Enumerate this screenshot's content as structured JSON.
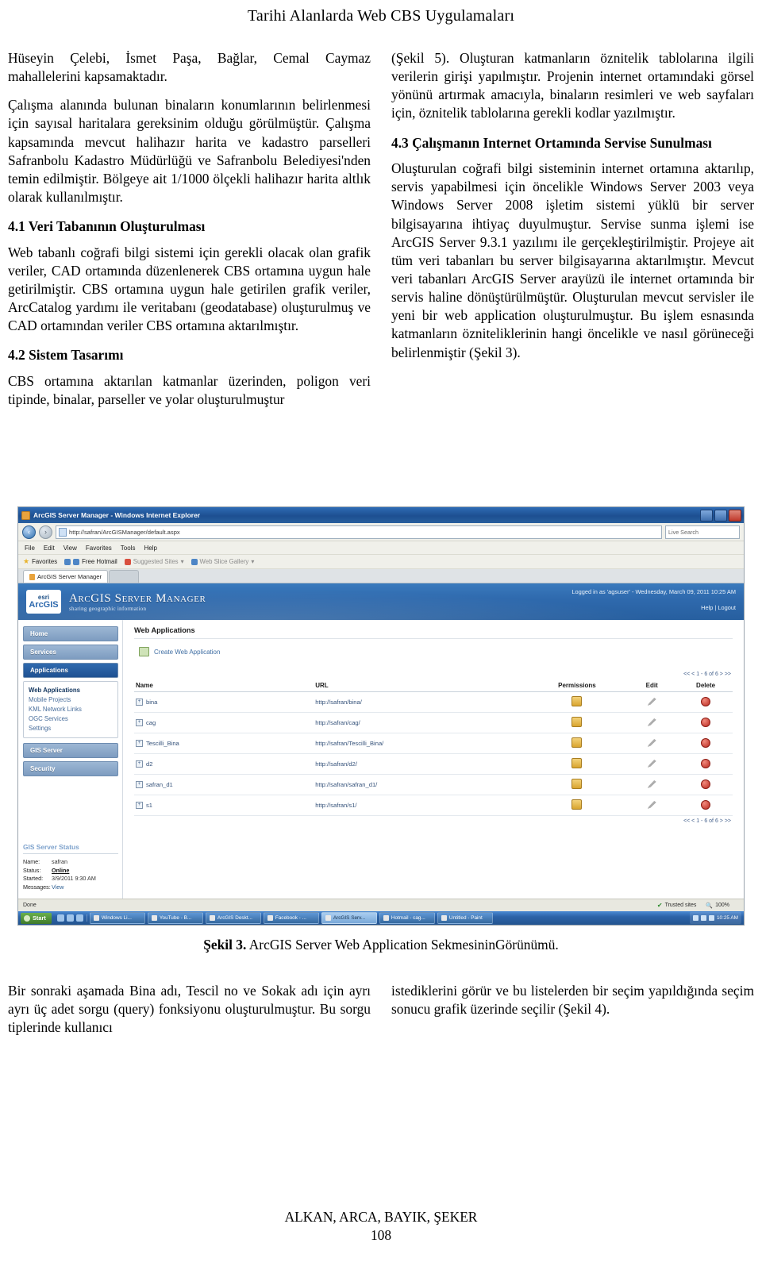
{
  "running_head": "Tarihi Alanlarda Web CBS Uygulamaları",
  "left_column": {
    "p1": "Hüseyin Çelebi, İsmet Paşa, Bağlar, Cemal Caymaz mahallelerini kapsamaktadır.",
    "p2": "Çalışma alanında bulunan binaların konumlarının belirlenmesi için sayısal haritalara gereksinim olduğu görülmüştür. Çalışma kapsamında mevcut halihazır harita ve kadastro parselleri Safranbolu Kadastro Müdürlüğü ve Safranbolu Belediyesi'nden temin edilmiştir. Bölgeye ait 1/1000 ölçekli halihazır harita altlık olarak kullanılmıştır.",
    "h_41": "4.1 Veri Tabanının Oluşturulması",
    "p3": "Web tabanlı coğrafi bilgi sistemi için gerekli olacak olan grafik veriler, CAD ortamında düzenlenerek CBS ortamına uygun hale getirilmiştir. CBS ortamına uygun hale getirilen grafik veriler, ArcCatalog yardımı ile veritabanı (geodatabase) oluşturulmuş ve CAD ortamından veriler CBS ortamına aktarılmıştır.",
    "h_42": "4.2 Sistem Tasarımı",
    "p4": "CBS ortamına aktarılan katmanlar üzerinden, poligon veri tipinde, binalar, parseller ve yolar oluşturulmuştur"
  },
  "right_column": {
    "p1": "(Şekil 5). Oluşturan katmanların öznitelik tablolarına ilgili verilerin girişi yapılmıştır. Projenin internet ortamındaki görsel yönünü artırmak amacıyla, binaların resimleri ve web sayfaları için, öznitelik tablolarına gerekli kodlar yazılmıştır.",
    "h_43": "4.3 Çalışmanın Internet Ortamında Servise Sunulması",
    "p2": "Oluşturulan coğrafi bilgi sisteminin internet ortamına aktarılıp, servis yapabilmesi için öncelikle Windows Server 2003 veya Windows Server 2008 işletim sistemi yüklü bir server bilgisayarına ihtiyaç duyulmuştur. Servise sunma işlemi ise ArcGIS Server 9.3.1 yazılımı ile gerçekleştirilmiştir. Projeye ait tüm veri tabanları bu server bilgisayarına aktarılmıştır. Mevcut veri tabanları ArcGIS Server arayüzü ile internet ortamında bir servis haline dönüştürülmüştür. Oluşturulan mevcut servisler ile yeni bir web application oluşturulmuştur. Bu işlem esnasında katmanların özniteliklerinin hangi öncelikle ve nasıl görüneceği belirlenmiştir (Şekil 3)."
  },
  "figure": {
    "caption_label": "Şekil 3.",
    "caption_text": " ArcGIS Server Web Application SekmesininGörünümü.",
    "browser": {
      "window_title": "ArcGIS Server Manager - Windows Internet Explorer",
      "address": "http://safran/ArcGISManager/default.aspx",
      "search_placeholder": "Live Search",
      "menu": [
        "File",
        "Edit",
        "View",
        "Favorites",
        "Tools",
        "Help"
      ],
      "favorites_label": "Favorites",
      "favorites_items": [
        "Free Hotmail",
        "Suggested Sites",
        "Web Slice Gallery"
      ],
      "tab_label": "ArcGIS Server Manager",
      "status_text": "Done",
      "zone_text": "Trusted sites",
      "zoom_text": "100%"
    },
    "app": {
      "brand_top": "ArcGIS",
      "brand_title": "ArcGIS Server Manager",
      "brand_subtitle": "sharing geographic information",
      "logged_in": "Logged in as 'agsuser' - Wednesday, March 09, 2011 10:25 AM",
      "help_logout": "Help | Logout",
      "nav": [
        {
          "label": "Home",
          "active": false
        },
        {
          "label": "Services",
          "active": false
        },
        {
          "label": "Applications",
          "active": true
        }
      ],
      "sub_nav": [
        {
          "label": "Web Applications",
          "selected": true
        },
        {
          "label": "Mobile Projects",
          "selected": false
        },
        {
          "label": "KML Network Links",
          "selected": false
        },
        {
          "label": "OGC Services",
          "selected": false
        },
        {
          "label": "Settings",
          "selected": false
        }
      ],
      "nav2": [
        {
          "label": "GIS Server",
          "active": false
        },
        {
          "label": "Security",
          "active": false
        }
      ],
      "status_panel": {
        "heading": "GIS Server Status",
        "rows": [
          {
            "key": "Name:",
            "value": "safran",
            "style": "plain"
          },
          {
            "key": "Status:",
            "value": "Online",
            "style": "online"
          },
          {
            "key": "Started:",
            "value": "3/9/2011 9:30 AM",
            "style": "plain"
          },
          {
            "key": "Messages:",
            "value": "View",
            "style": "link"
          }
        ]
      },
      "content_title": "Web Applications",
      "create_label": "Create Web Application",
      "table_headers": [
        "Name",
        "URL",
        "Permissions",
        "Edit",
        "Delete"
      ],
      "pager_text": "<< < 1 - 6 of 6 > >>",
      "rows": [
        {
          "name": "bina",
          "url": "http://safran/bina/"
        },
        {
          "name": "cag",
          "url": "http://safran/cag/"
        },
        {
          "name": "Tescilli_Bina",
          "url": "http://safran/Tescilli_Bina/"
        },
        {
          "name": "d2",
          "url": "http://safran/d2/"
        },
        {
          "name": "safran_d1",
          "url": "http://safran/safran_d1/"
        },
        {
          "name": "s1",
          "url": "http://safran/s1/"
        }
      ],
      "taskbar": {
        "start_label": "Start",
        "buttons": [
          "Windows Li...",
          "YouTube - B...",
          "ArcGIS Deskt...",
          "Facebook - ...",
          "Hotmail - cag...",
          "Untitled - Paint"
        ],
        "active_button": "ArcGIS Serv...",
        "clock": "10:25 AM"
      }
    }
  },
  "bottom_left": "Bir sonraki aşamada Bina adı, Tescil no ve Sokak adı için ayrı ayrı üç adet sorgu (query) fonksiyonu oluşturulmuştur. Bu sorgu tiplerinde kullanıcı",
  "bottom_right": "istediklerini görür ve bu listelerden bir seçim yapıldığında seçim sonucu grafik üzerinde seçilir (Şekil 4).",
  "footer": {
    "authors": "ALKAN, ARCA, BAYIK, ŞEKER",
    "page_number": "108"
  }
}
